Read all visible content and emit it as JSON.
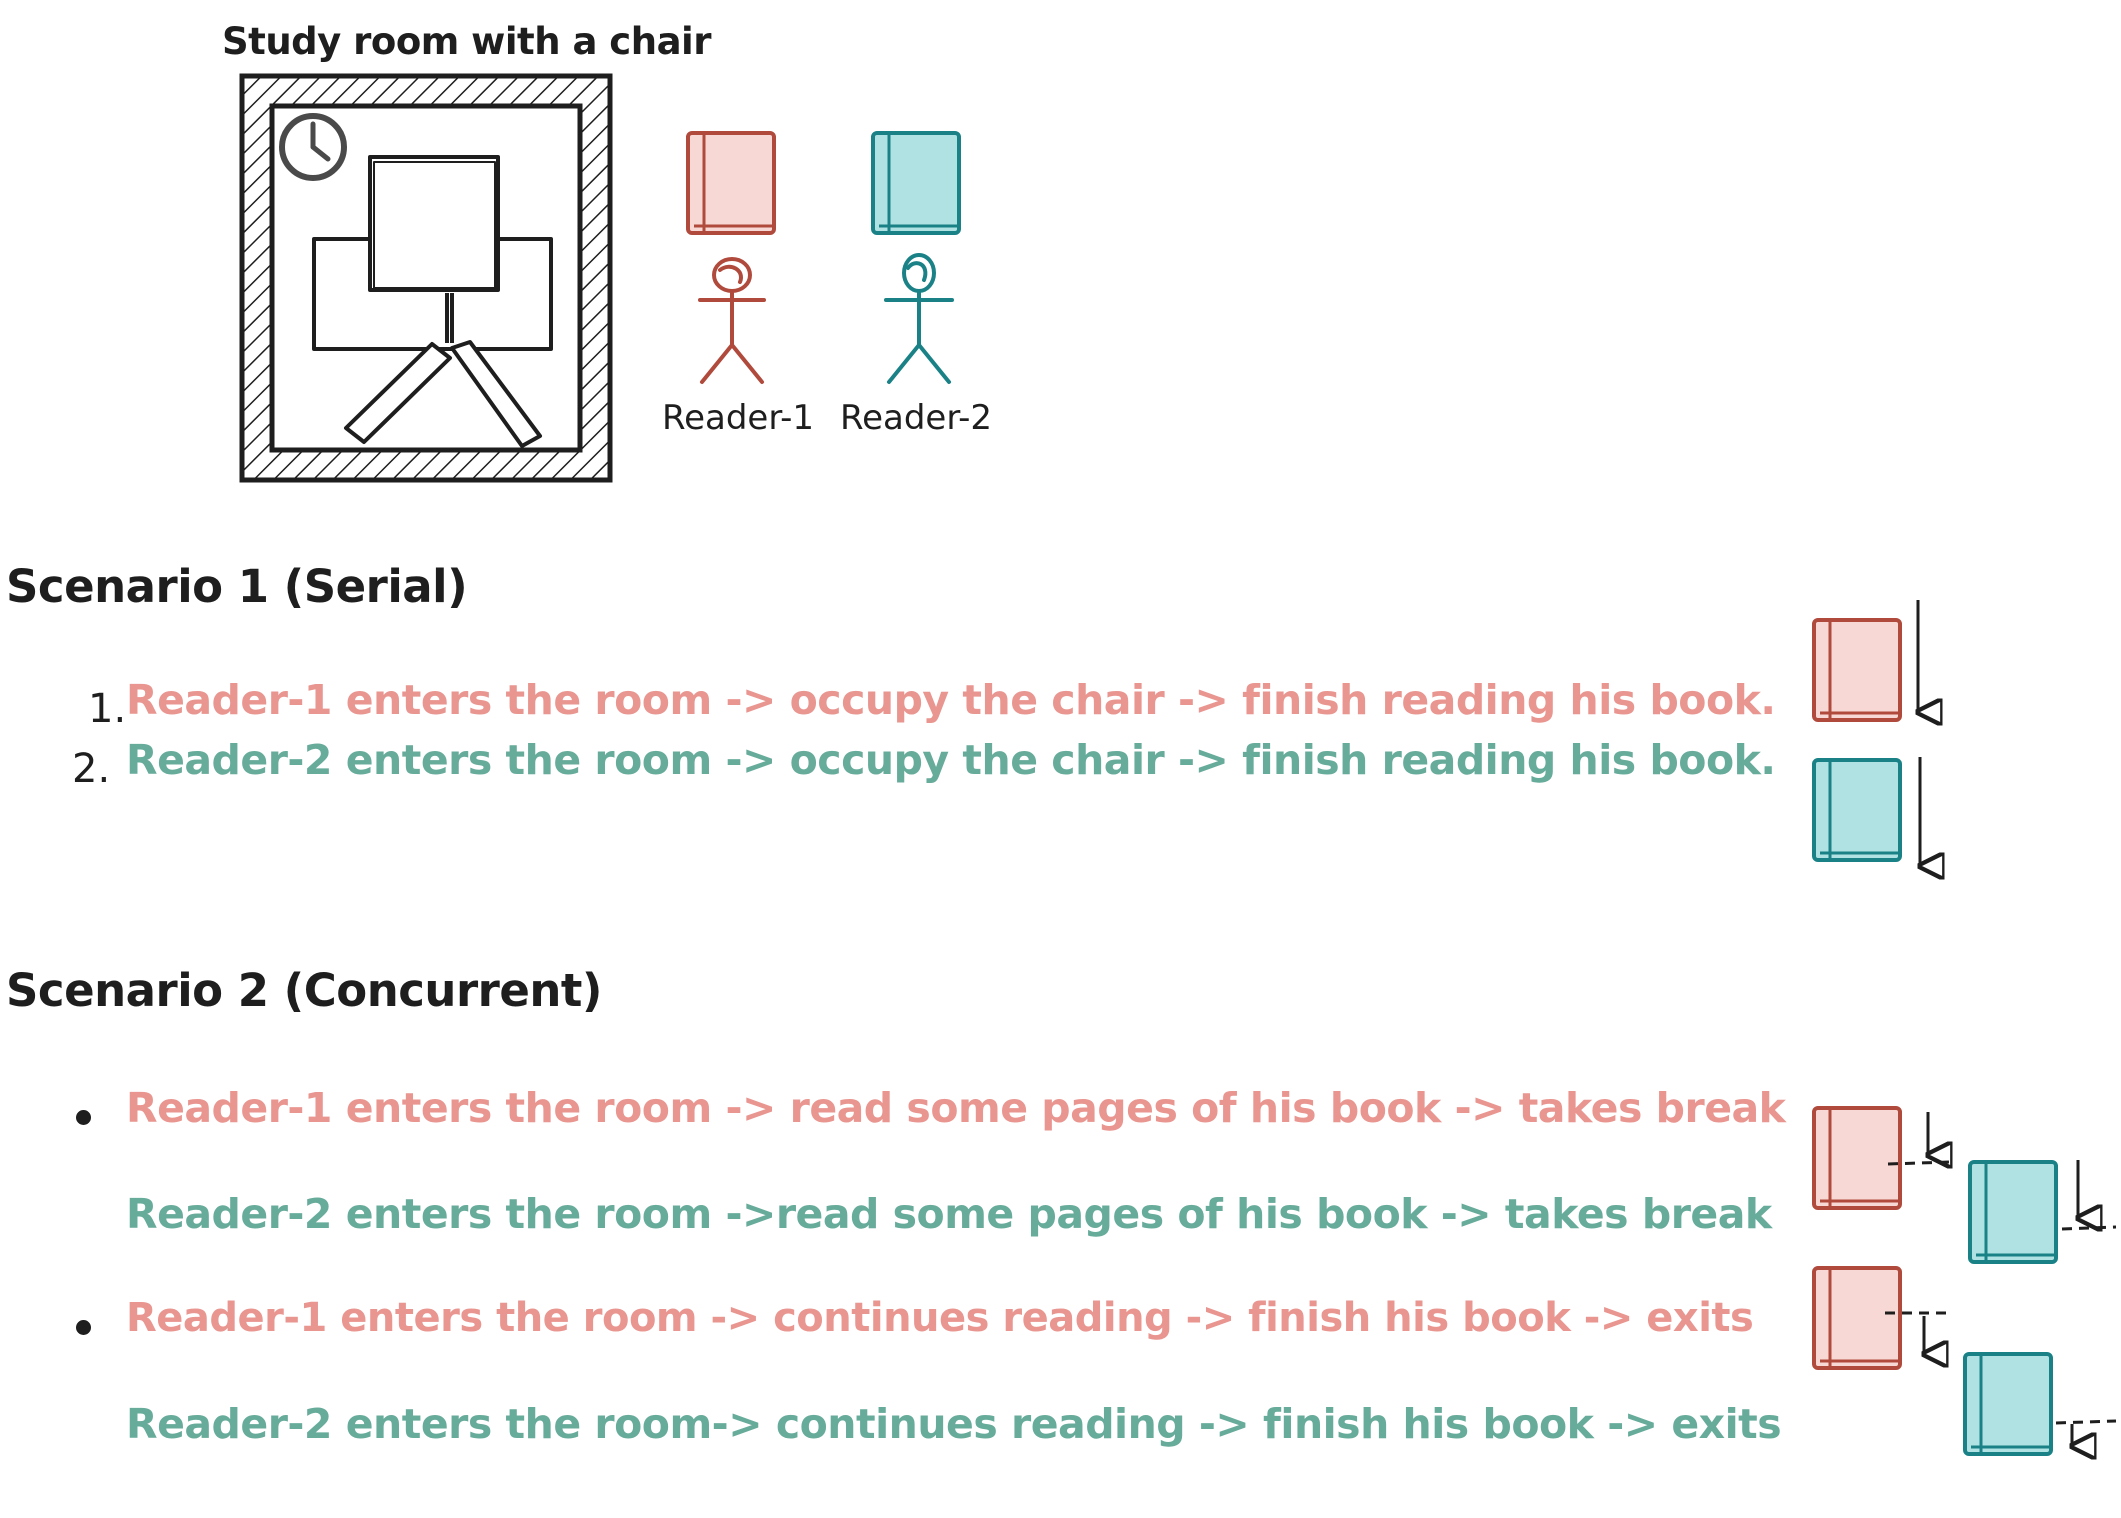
{
  "room": {
    "title": "Study room with a chair",
    "readers": [
      {
        "label": "Reader-1",
        "color": "#b04a3c",
        "book_fill": "#f8d8d4"
      },
      {
        "label": "Reader-2",
        "color": "#1a8287",
        "book_fill": "#b0e2e3"
      }
    ]
  },
  "scenario1": {
    "heading": "Scenario 1 (Serial)",
    "items": [
      {
        "marker": "1.",
        "text": "Reader-1 enters the room -> occupy the chair -> finish reading his book."
      },
      {
        "marker": "2.",
        "text": "Reader-2 enters the room -> occupy the chair -> finish reading his book."
      }
    ]
  },
  "scenario2": {
    "heading": "Scenario 2 (Concurrent)",
    "lines": [
      "Reader-1 enters the room -> read some pages of his book -> takes break",
      "Reader-2 enters the room ->read some pages of his book -> takes break",
      "Reader-1 enters the room -> continues reading -> finish his book -> exits",
      "Reader-2 enters the room-> continues reading -> finish his book -> exits"
    ]
  },
  "colors": {
    "reader1_text": "#e99590",
    "reader2_text": "#67ab9b",
    "ink": "#1e1e1e"
  }
}
